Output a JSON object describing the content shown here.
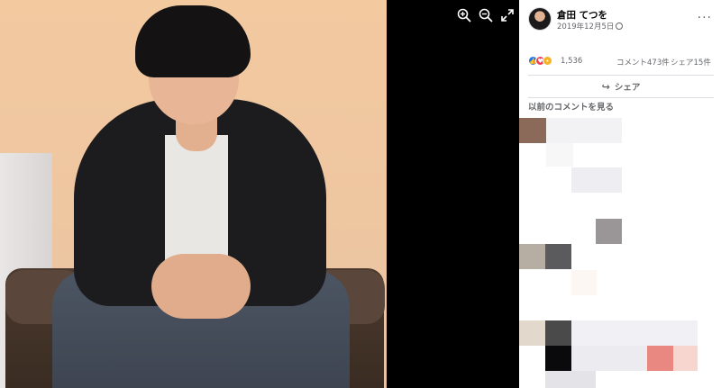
{
  "post": {
    "author": "倉田 てつを",
    "date": "2019年12月5日",
    "privacy_icon": "globe-icon",
    "more_label": "···"
  },
  "viewer": {
    "tools": [
      {
        "name": "zoom-in-icon"
      },
      {
        "name": "zoom-out-icon"
      },
      {
        "name": "fullscreen-icon"
      }
    ]
  },
  "stats": {
    "reactions": [
      "like",
      "love",
      "wow"
    ],
    "reaction_count": "1,536",
    "comments": "コメント473件",
    "shares": "シェア15件"
  },
  "actions": {
    "share_label": "シェア"
  },
  "comments": {
    "previous_label": "以前のコメントを見る"
  },
  "colors": {
    "like": "#1877f2",
    "love": "#f33e58",
    "wow": "#f7b125",
    "secondary_text": "#65676b"
  }
}
